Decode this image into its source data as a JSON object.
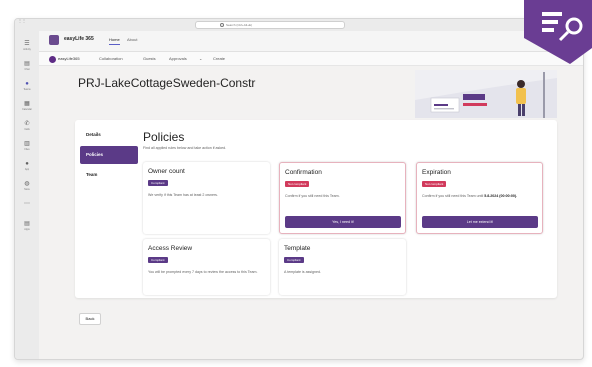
{
  "titlebar": {
    "window_label": "Teams",
    "search_placeholder": "Search (Ctrl+Alt+E)"
  },
  "rail": [
    {
      "icon": "activity-icon",
      "glyph": "☰",
      "label": "Activity"
    },
    {
      "icon": "chat-icon",
      "glyph": "▤",
      "label": "Chat"
    },
    {
      "icon": "teams-icon",
      "glyph": "●",
      "label": "Teams"
    },
    {
      "icon": "calendar-icon",
      "glyph": "▦",
      "label": "Calendar"
    },
    {
      "icon": "calls-icon",
      "glyph": "✆",
      "label": "Calls"
    },
    {
      "icon": "files-icon",
      "glyph": "▥",
      "label": "Files"
    },
    {
      "icon": "app-icon",
      "glyph": "●",
      "label": "App"
    },
    {
      "icon": "store-icon",
      "glyph": "◍",
      "label": "Store"
    },
    {
      "icon": "more-icon",
      "glyph": "⋯",
      "label": ""
    },
    {
      "icon": "apps-icon",
      "glyph": "▤",
      "label": "Apps"
    }
  ],
  "tabs_bar": {
    "app_title": "easyLife 365",
    "tabs": [
      "Home",
      "About"
    ],
    "active_tab": "Home"
  },
  "top_nav": {
    "brand": "easyLife365",
    "items": [
      "Collaboration",
      "Guests",
      "Approvals",
      "Create"
    ]
  },
  "page": {
    "title": "PRJ-LakeCottageSweden-Constr"
  },
  "sidenav": [
    "Details",
    "Policies",
    "Team"
  ],
  "sidenav_active": "Policies",
  "policies": {
    "title": "Policies",
    "subtitle": "Find all applied rules below and take action if asked.",
    "cards": [
      {
        "title": "Owner count",
        "status": "Compliant",
        "status_type": "ok",
        "desc": "We verify if this Team has at least 2 owners.",
        "button": ""
      },
      {
        "title": "Confirmation",
        "status": "Not compliant",
        "status_type": "bad",
        "desc": "Confirm if you still need this Team.",
        "button": "Yes, I need it!"
      },
      {
        "title": "Expiration",
        "status": "Not compliant",
        "status_type": "bad",
        "desc_prefix": "Confirm if you still need this Team until",
        "desc_date": "5.8.2024 (00:00:00).",
        "button": "Let me extend it!"
      },
      {
        "title": "Access Review",
        "status": "Compliant",
        "status_type": "ok",
        "desc": "You will be prompted every 7 days to review the access to this Team.",
        "button": ""
      },
      {
        "title": "Template",
        "status": "Compliant",
        "status_type": "ok",
        "desc": "A template is assigned.",
        "button": ""
      }
    ]
  },
  "footer": {
    "back_label": "Back"
  },
  "colors": {
    "brand_purple": "#5b3a87",
    "error_pink": "#d13a5c",
    "teams_accent": "#5b5fc7"
  }
}
